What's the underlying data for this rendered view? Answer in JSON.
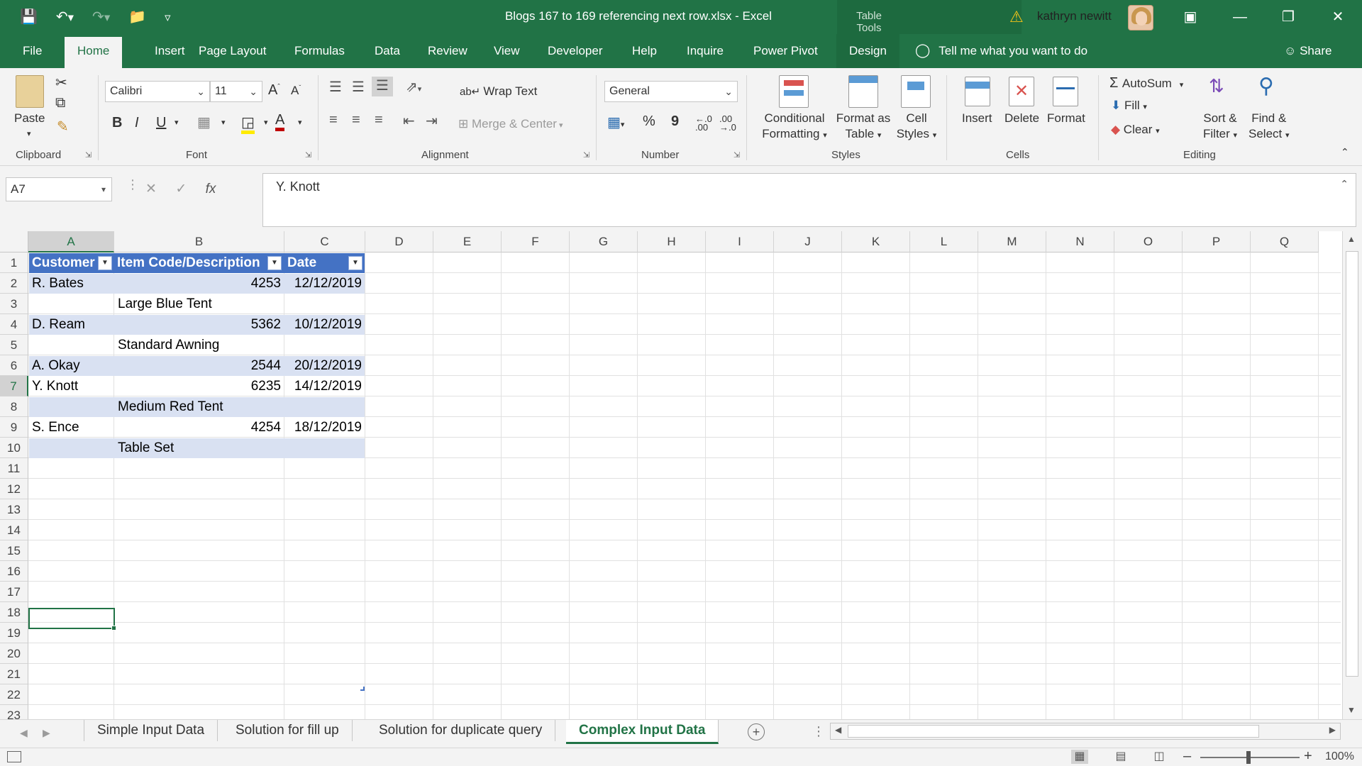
{
  "window": {
    "title": "Blogs 167 to 169 referencing next row.xlsx  -  Excel",
    "context_label": "Table Tools",
    "user": "kathryn newitt",
    "accent_color": "#217346"
  },
  "quick_access": [
    "save-icon",
    "undo-icon",
    "redo-icon",
    "open-icon",
    "customize-icon"
  ],
  "ribbon_tabs": [
    "File",
    "Home",
    "Insert",
    "Page Layout",
    "Formulas",
    "Data",
    "Review",
    "View",
    "Developer",
    "Help",
    "Inquire",
    "Power Pivot",
    "Design"
  ],
  "active_tab": "Home",
  "tell_me": "Tell me what you want to do",
  "share": "Share",
  "ribbon": {
    "clipboard": {
      "label": "Clipboard",
      "paste": "Paste"
    },
    "font": {
      "label": "Font",
      "name": "Calibri",
      "size": "11",
      "bold": "B",
      "italic": "I",
      "underline": "U"
    },
    "alignment": {
      "label": "Alignment",
      "wrap_text": "Wrap Text",
      "merge_center": "Merge & Center"
    },
    "number": {
      "label": "Number",
      "format": "General",
      "percent": "%",
      "comma": "9"
    },
    "styles": {
      "label": "Styles",
      "conditional_1": "Conditional",
      "conditional_2": "Formatting",
      "format_table_1": "Format as",
      "format_table_2": "Table",
      "cell_styles_1": "Cell",
      "cell_styles_2": "Styles"
    },
    "cells": {
      "label": "Cells",
      "insert": "Insert",
      "delete": "Delete",
      "format": "Format"
    },
    "editing": {
      "label": "Editing",
      "autosum": "AutoSum",
      "fill": "Fill",
      "clear": "Clear",
      "sort_1": "Sort &",
      "sort_2": "Filter",
      "find_1": "Find &",
      "find_2": "Select"
    }
  },
  "formula_bar": {
    "name_box": "A7",
    "fx": "fx",
    "content": "Y. Knott"
  },
  "columns": [
    "A",
    "B",
    "C",
    "D",
    "E",
    "F",
    "G",
    "H",
    "I",
    "J",
    "K",
    "L",
    "M",
    "N",
    "O",
    "P",
    "Q"
  ],
  "rows": [
    "1",
    "2",
    "3",
    "4",
    "5",
    "6",
    "7",
    "8",
    "9",
    "10",
    "11",
    "12",
    "13",
    "14",
    "15",
    "16",
    "17",
    "18",
    "19",
    "20",
    "21",
    "22",
    "23"
  ],
  "table": {
    "headers": [
      "Customer",
      "Item Code/Description",
      "Date"
    ],
    "rows": [
      [
        "R. Bates",
        "4253",
        "12/12/2019"
      ],
      [
        "",
        "Large Blue Tent",
        ""
      ],
      [
        "D. Ream",
        "5362",
        "10/12/2019"
      ],
      [
        "",
        "Standard Awning",
        ""
      ],
      [
        "A. Okay",
        "2544",
        "20/12/2019"
      ],
      [
        "Y. Knott",
        "6235",
        "14/12/2019"
      ],
      [
        "",
        "Medium Red Tent",
        ""
      ],
      [
        "S. Ence",
        "4254",
        "18/12/2019"
      ],
      [
        "",
        "Table Set",
        ""
      ]
    ],
    "header_color": "#4472c4",
    "band_color": "#d9e1f2"
  },
  "selected_cell": "A7",
  "sheets": [
    "Simple Input Data",
    "Solution for fill up",
    "Solution for duplicate query",
    "Complex Input Data"
  ],
  "active_sheet": "Complex Input Data",
  "status": {
    "zoom": "100%"
  }
}
